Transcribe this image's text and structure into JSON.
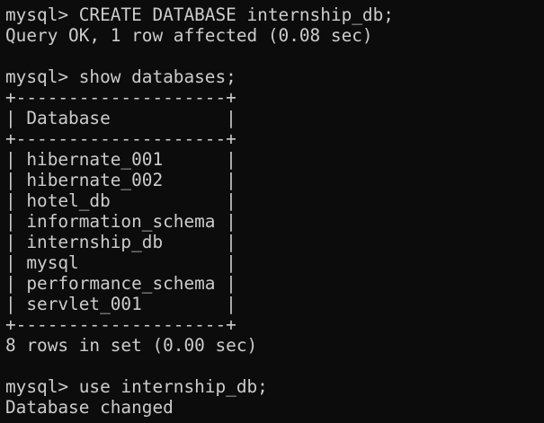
{
  "terminal": {
    "create_command": "mysql> CREATE DATABASE internship_db;",
    "create_result": "Query OK, 1 row affected (0.08 sec)",
    "show_command": "mysql> show databases;",
    "table_border": "+--------------------+",
    "table_header": "| Database           |",
    "rows": [
      "| hibernate_001      |",
      "| hibernate_002      |",
      "| hotel_db           |",
      "| information_schema |",
      "| internship_db      |",
      "| mysql              |",
      "| performance_schema |",
      "| servlet_001        |"
    ],
    "show_result": "8 rows in set (0.00 sec)",
    "use_command": "mysql> use internship_db;",
    "use_result": "Database changed"
  }
}
